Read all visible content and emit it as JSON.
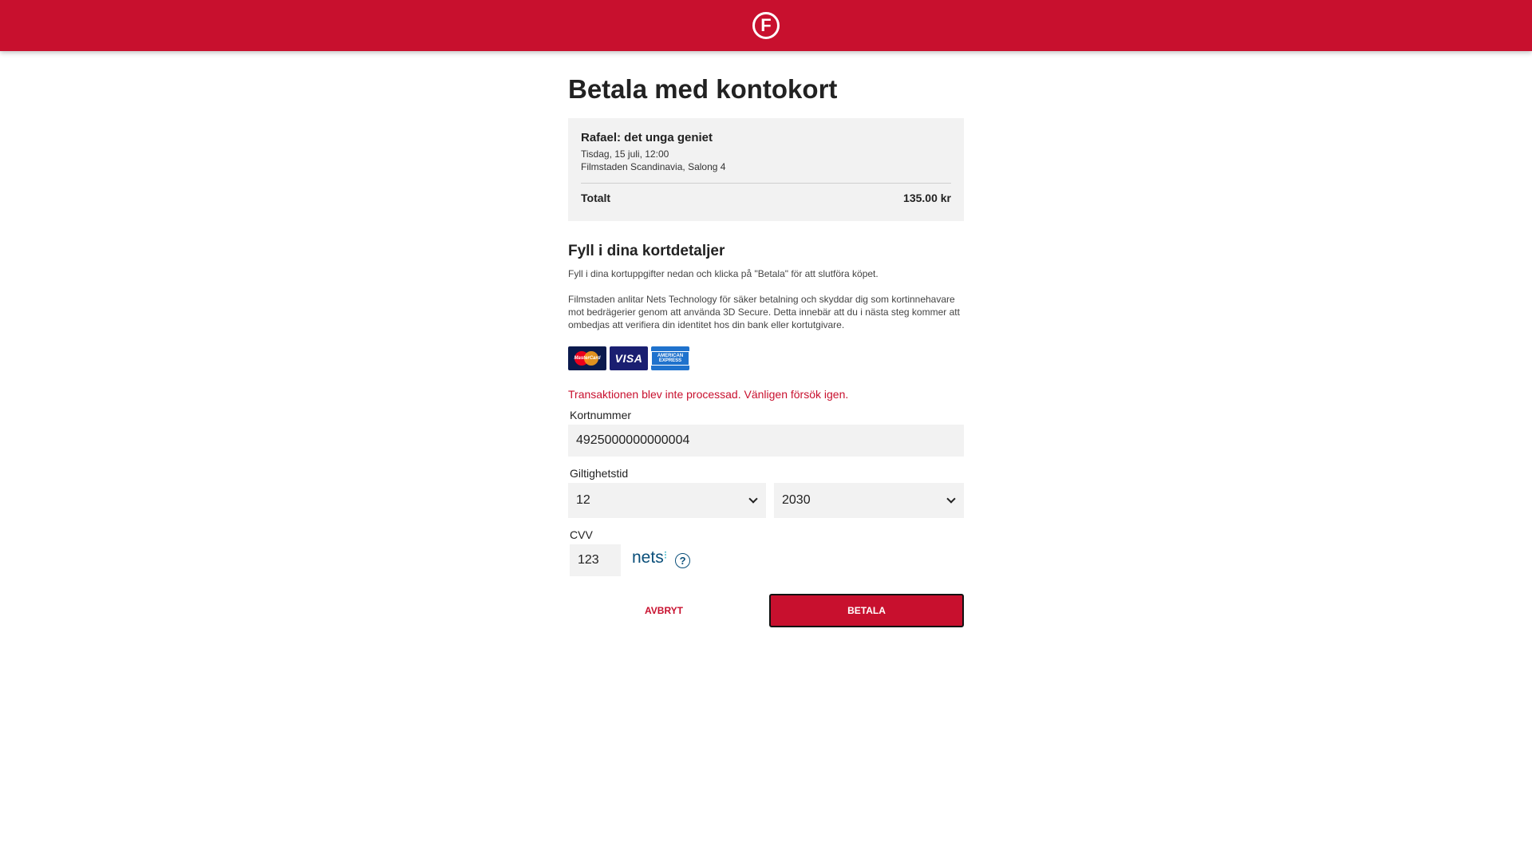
{
  "header": {
    "logo_letter": "F",
    "brand_color": "#c8102e"
  },
  "page": {
    "title": "Betala med kontokort"
  },
  "summary": {
    "movie": "Rafael: det unga geniet",
    "datetime": "Tisdag, 15 juli, 12:00",
    "venue": "Filmstaden Scandinavia, Salong 4",
    "total_label": "Totalt",
    "total_value": "135.00 kr"
  },
  "card_section": {
    "title": "Fyll i dina kortdetaljer",
    "instructions": "Fyll i dina kortuppgifter nedan och klicka på \"Betala\" för att slutföra köpet.",
    "info": "Filmstaden anlitar Nets Technology för säker betalning och skyddar dig som kortinnehavare mot bedrägerier genom att använda 3D Secure. Detta innebär att du i nästa steg kommer att ombedjas att verifiera din identitet hos din bank eller kortutgivare.",
    "card_logos": [
      "mastercard-icon",
      "visa-icon",
      "amex-icon"
    ],
    "mastercard_text": "MasterCard",
    "visa_text": "VISA",
    "amex_text": "AMERICAN EXPRESS"
  },
  "error": {
    "message": "Transaktionen blev inte processad. Vänligen försök igen.",
    "color": "#c8102e"
  },
  "form": {
    "card_number_label": "Kortnummer",
    "card_number_value": "4925000000000004",
    "expiry_label": "Giltighetstid",
    "expiry_month": "12",
    "expiry_year": "2030",
    "cvv_label": "CVV",
    "cvv_value": "123",
    "nets_logo_text": "nets",
    "help_symbol": "?"
  },
  "actions": {
    "cancel_label": "AVBRYT",
    "pay_label": "BETALA"
  }
}
